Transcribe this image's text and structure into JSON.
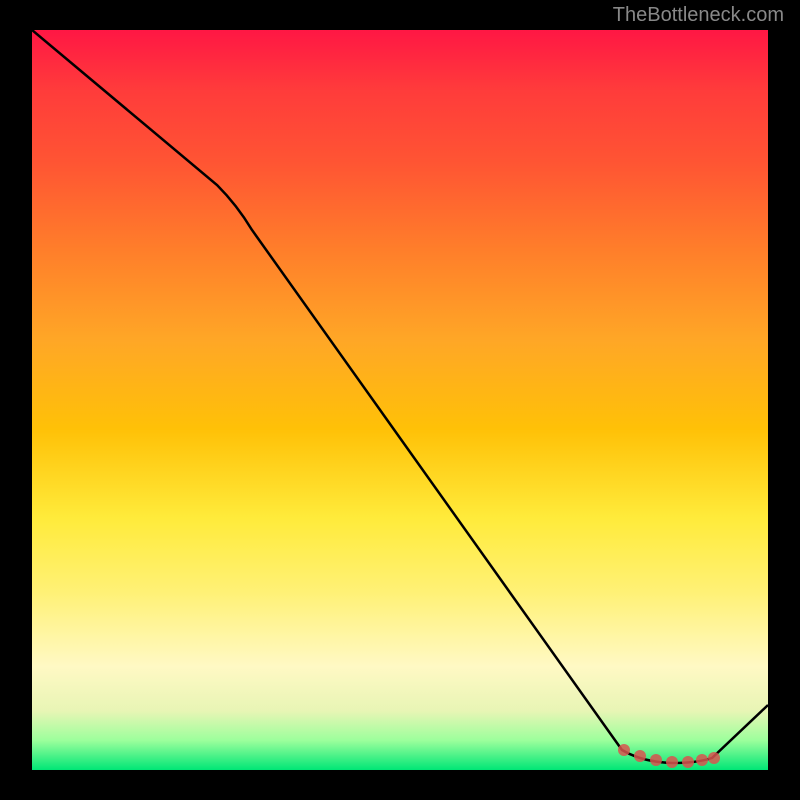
{
  "watermark": "TheBottleneck.com",
  "chart_data": {
    "type": "line",
    "title": "",
    "xlabel": "",
    "ylabel": "",
    "ylim": [
      0,
      100
    ],
    "xlim": [
      0,
      100
    ],
    "series": [
      {
        "name": "curve",
        "points": [
          {
            "x": 0,
            "y": 99
          },
          {
            "x": 25,
            "y": 79
          },
          {
            "x": 80,
            "y": 2
          },
          {
            "x": 87,
            "y": 0.5
          },
          {
            "x": 92,
            "y": 1
          },
          {
            "x": 100,
            "y": 9
          }
        ]
      }
    ],
    "markers": [
      {
        "x": 80,
        "y": 2
      },
      {
        "x": 82.5,
        "y": 1.3
      },
      {
        "x": 85,
        "y": 0.9
      },
      {
        "x": 87,
        "y": 0.7
      },
      {
        "x": 89,
        "y": 0.8
      },
      {
        "x": 91,
        "y": 1.0
      },
      {
        "x": 92.5,
        "y": 1.2
      }
    ]
  }
}
